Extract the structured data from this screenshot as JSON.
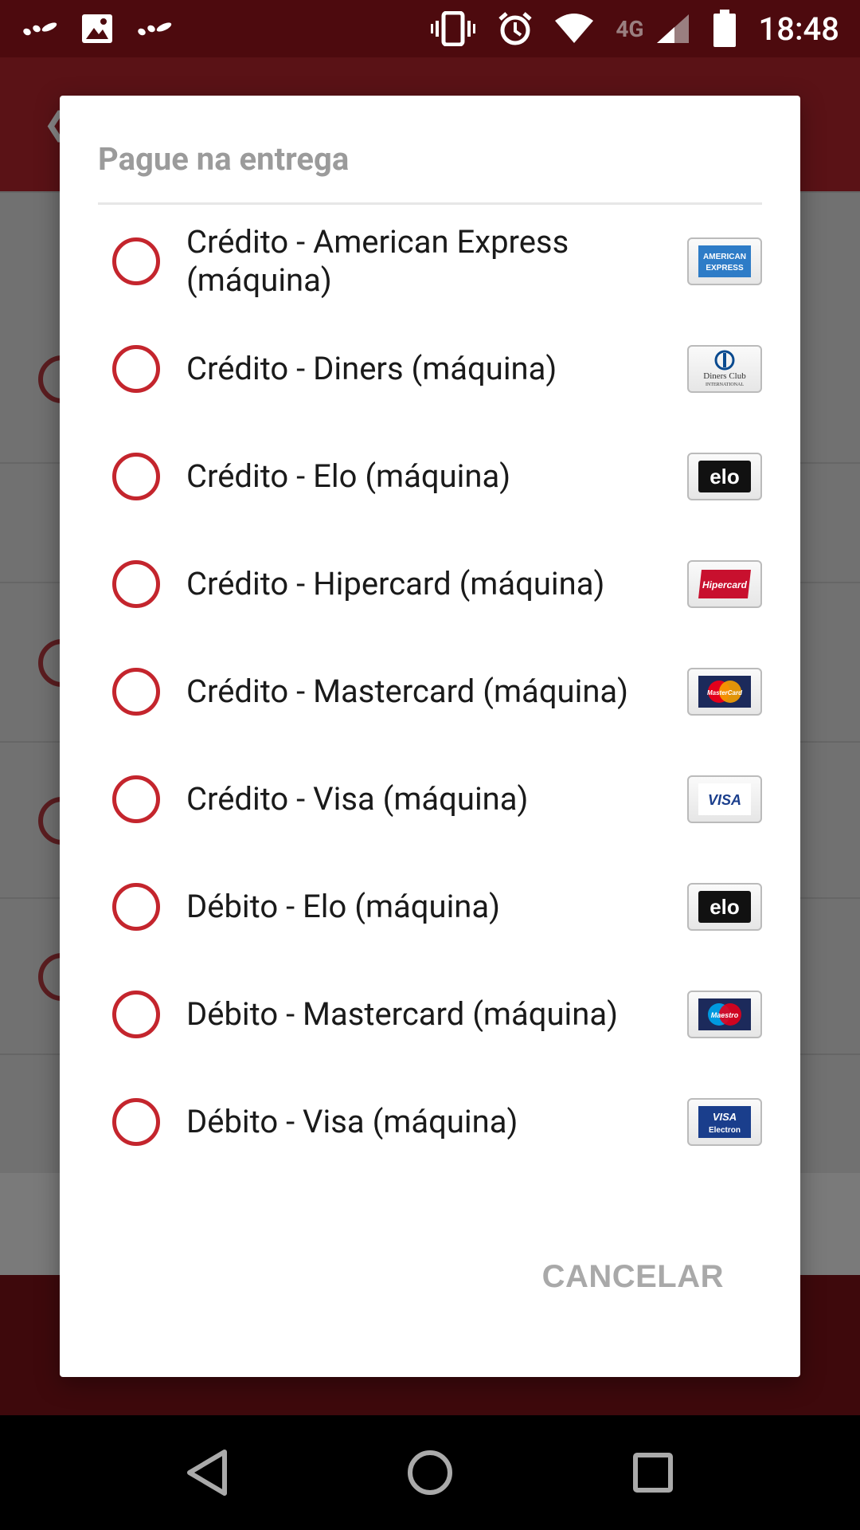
{
  "status_bar": {
    "time": "18:48",
    "network": "4G"
  },
  "dialog": {
    "title": "Pague na entrega",
    "options": [
      {
        "label": "Crédito - American Express (máquina)",
        "logo": "amex-logo"
      },
      {
        "label": "Crédito - Diners (máquina)",
        "logo": "diners-logo"
      },
      {
        "label": "Crédito - Elo (máquina)",
        "logo": "elo-logo"
      },
      {
        "label": "Crédito - Hipercard (máquina)",
        "logo": "hipercard-logo"
      },
      {
        "label": "Crédito - Mastercard (máquina)",
        "logo": "mastercard-logo"
      },
      {
        "label": "Crédito - Visa (máquina)",
        "logo": "visa-logo"
      },
      {
        "label": "Débito - Elo (máquina)",
        "logo": "elo-logo"
      },
      {
        "label": "Débito - Mastercard (máquina)",
        "logo": "maestro-logo"
      },
      {
        "label": "Débito - Visa (máquina)",
        "logo": "visa-electron-logo"
      }
    ],
    "cancel_label": "CANCELAR"
  },
  "colors": {
    "status_bar": "#4d0a0e",
    "accent": "#c4252d",
    "title_text": "#9b9b9b",
    "cancel_text": "#a9a9a9"
  }
}
